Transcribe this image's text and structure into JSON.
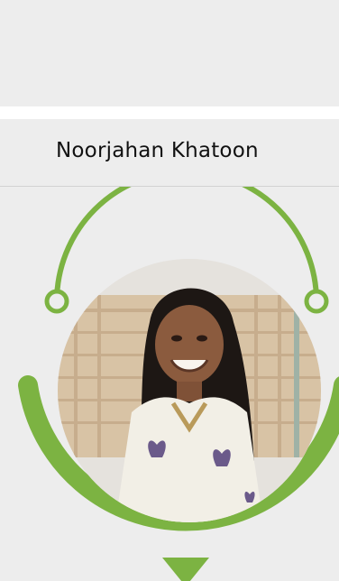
{
  "profile": {
    "name": "Noorjahan Khatoon",
    "photo_icon": "profile-photo"
  },
  "colors": {
    "background": "#ededed",
    "accent": "#7cb342",
    "divider": "#d2d2d2",
    "text": "#111111"
  }
}
